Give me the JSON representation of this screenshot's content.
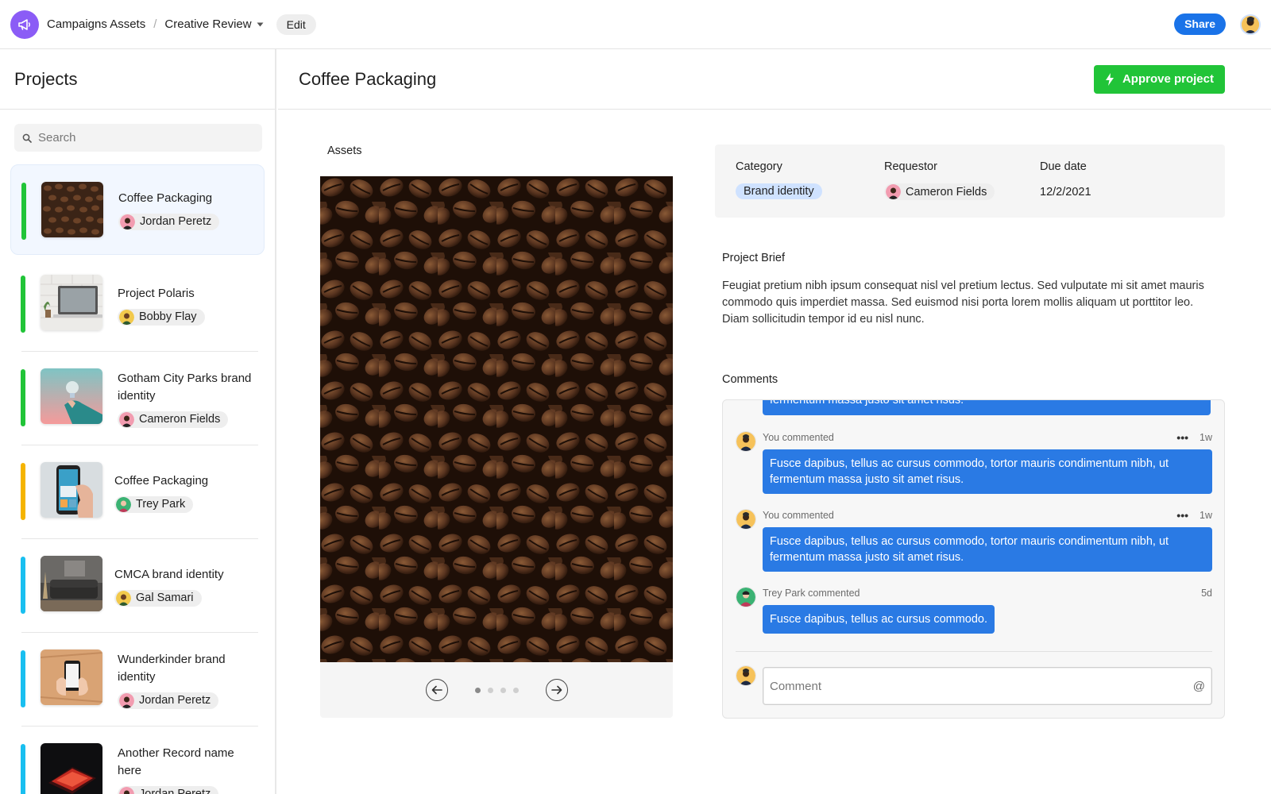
{
  "header": {
    "breadcrumb_root": "Campaigns Assets",
    "breadcrumb_separator": "/",
    "breadcrumb_current": "Creative Review",
    "edit_label": "Edit",
    "share_label": "Share",
    "logo_icon": "megaphone-icon",
    "accent": "#8b5cf6"
  },
  "sidebar": {
    "title": "Projects",
    "search_placeholder": "Search",
    "projects": [
      {
        "name": "Coffee Packaging",
        "owner": "Jordan Peretz",
        "accent": "#21c438"
      },
      {
        "name": "Project Polaris",
        "owner": "Bobby Flay",
        "accent": "#21c438"
      },
      {
        "name": "Gotham City Parks brand identity",
        "owner": "Cameron Fields",
        "accent": "#21c438"
      },
      {
        "name": "Coffee Packaging",
        "owner": "Trey Park",
        "accent": "#f5b400"
      },
      {
        "name": "CMCA brand identity",
        "owner": "Gal Samari",
        "accent": "#19bff0"
      },
      {
        "name": "Wunderkinder brand identity",
        "owner": "Jordan Peretz",
        "accent": "#19bff0"
      },
      {
        "name": "Another Record name here",
        "owner": "Jordan Peretz",
        "accent": "#19bff0"
      }
    ]
  },
  "main": {
    "title": "Coffee Packaging",
    "approve_label": "Approve project",
    "approve_color": "#21c438",
    "assets_label": "Assets",
    "carousel": {
      "current": 1,
      "total": 4
    },
    "meta": {
      "category_label": "Category",
      "category_value": "Brand identity",
      "requestor_label": "Requestor",
      "requestor_value": "Cameron Fields",
      "due_label": "Due date",
      "due_value": "12/2/2021"
    },
    "brief_title": "Project Brief",
    "brief_text": "Feugiat pretium nibh ipsum consequat nisl vel pretium lectus. Sed vulputate mi sit amet mauris commodo quis imperdiet massa. Sed euismod nisi porta lorem mollis aliquam ut porttitor leo. Diam sollicitudin tempor id eu nisl nunc.",
    "comments_title": "Comments",
    "comments_cutoff_text": "fermentum massa justo sit amet risus.",
    "comments": [
      {
        "author": "You commented",
        "time": "1w",
        "text": "Fusce dapibus, tellus ac cursus commodo, tortor mauris condimentum nibh, ut fermentum massa justo sit amet risus.",
        "show_more": true
      },
      {
        "author": "You commented",
        "time": "1w",
        "text": "Fusce dapibus, tellus ac cursus commodo, tortor mauris condimentum nibh, ut fermentum massa justo sit amet risus.",
        "show_more": true
      },
      {
        "author": "Trey Park commented",
        "time": "5d",
        "text": "Fusce dapibus, tellus ac cursus commodo.",
        "show_more": false
      }
    ],
    "comment_placeholder": "Comment",
    "mention_symbol": "@",
    "more_symbol": "•••",
    "bubble_color": "#2a7ae4"
  }
}
